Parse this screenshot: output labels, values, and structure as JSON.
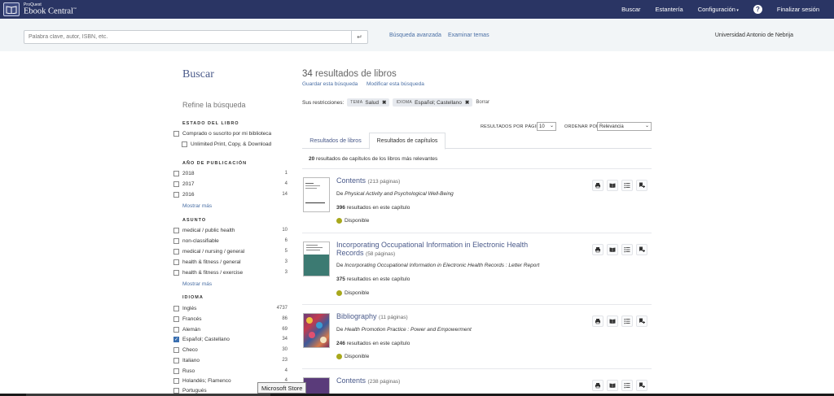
{
  "header": {
    "logo_small": "ProQuest",
    "logo_big": "Ebook Central",
    "logo_tm": "™",
    "nav": {
      "search": "Buscar",
      "bookshelf": "Estantería",
      "settings": "Configuración",
      "logout": "Finalizar sesión"
    },
    "help": "?"
  },
  "search": {
    "placeholder": "Palabra clave, autor, ISBN, etc.",
    "advanced": "Búsqueda avanzada",
    "browse": "Examinar temas",
    "institution": "Universidad Antonio de Nebrija"
  },
  "sidebar": {
    "title": "Buscar",
    "refine": "Refine la búsqueda",
    "book_status": {
      "heading": "ESTADO DEL LIBRO",
      "items": [
        {
          "label": "Comprado o suscrito por mi biblioteca",
          "count": "",
          "checked": false
        },
        {
          "label": "Unlimited Print, Copy, & Download",
          "count": "",
          "checked": false
        }
      ]
    },
    "year": {
      "heading": "AÑO DE PUBLICACIÓN",
      "items": [
        {
          "label": "2018",
          "count": "1",
          "checked": false
        },
        {
          "label": "2017",
          "count": "4",
          "checked": false
        },
        {
          "label": "2016",
          "count": "14",
          "checked": false
        }
      ],
      "more": "Mostrar más"
    },
    "subject": {
      "heading": "ASUNTO",
      "items": [
        {
          "label": "medical / public health",
          "count": "10",
          "checked": false
        },
        {
          "label": "non-classifiable",
          "count": "6",
          "checked": false
        },
        {
          "label": "medical / nursing / general",
          "count": "5",
          "checked": false
        },
        {
          "label": "health & fitness / general",
          "count": "3",
          "checked": false
        },
        {
          "label": "health & fitness / exercise",
          "count": "3",
          "checked": false
        }
      ],
      "more": "Mostrar más"
    },
    "language": {
      "heading": "IDIOMA",
      "items": [
        {
          "label": "Inglés",
          "count": "4737",
          "checked": false
        },
        {
          "label": "Francés",
          "count": "86",
          "checked": false
        },
        {
          "label": "Alemán",
          "count": "69",
          "checked": false
        },
        {
          "label": "Español; Castellano",
          "count": "34",
          "checked": true
        },
        {
          "label": "Checo",
          "count": "30",
          "checked": false
        },
        {
          "label": "Italiano",
          "count": "23",
          "checked": false
        },
        {
          "label": "Ruso",
          "count": "4",
          "checked": false
        },
        {
          "label": "Holandés; Flamenco",
          "count": "4",
          "checked": false
        },
        {
          "label": "Portugués",
          "count": "",
          "checked": false
        }
      ]
    }
  },
  "main": {
    "results_count": "34",
    "results_label": "resultados de libros",
    "save_search": "Guardar esta búsqueda",
    "modify_search": "Modificar esta búsqueda",
    "restrictions_label": "Sus restricciones:",
    "restrictions": [
      {
        "key": "TEMA",
        "value": "Salud"
      },
      {
        "key": "IDIOMA",
        "value": "Español; Castellano"
      }
    ],
    "clear": "Borrar",
    "per_page_label": "RESULTADOS POR PÁGINA",
    "per_page_value": "10",
    "sort_label": "ORDENAR POR",
    "sort_value": "Relevancia",
    "tabs": [
      "Resultados de libros",
      "Resultados de capítulos"
    ],
    "summary_count": "20",
    "summary_text": "resultados de capítulos de los libros más relevantes",
    "from_label": "De",
    "count_suffix": "resultados en este capítulo",
    "items": [
      {
        "title": "Contents",
        "pages": "(213 páginas)",
        "from": "Physical Activity and Psychological Well-Being",
        "count": "396",
        "status": "Disponible"
      },
      {
        "title": "Incorporating Occupational Information in Electronic Health Records",
        "pages": "(58 páginas)",
        "from": "Incorporating Occupational Information in Electronic Health Records : Letter Report",
        "count": "375",
        "status": "Disponible"
      },
      {
        "title": "Bibliography",
        "pages": "(11 páginas)",
        "from": "Health Promotion Practice : Power and Empowerment",
        "count": "246",
        "status": "Disponible"
      },
      {
        "title": "Contents",
        "pages": "(238 páginas)",
        "from": "",
        "count": "",
        "status": ""
      }
    ]
  },
  "tooltip": "Microsoft Store"
}
